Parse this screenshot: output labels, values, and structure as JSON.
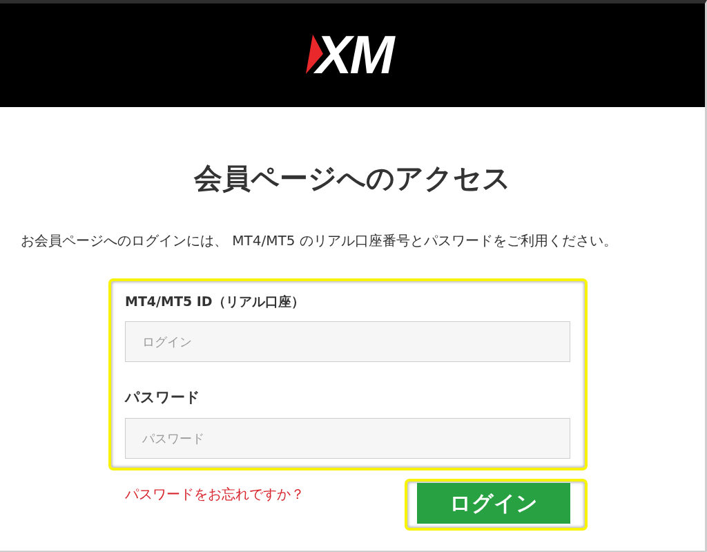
{
  "header": {
    "logo_text": "XM"
  },
  "title": "会員ページへのアクセス",
  "description": "お会員ページへのログインには、 MT4/MT5 のリアル口座番号とパスワードをご利用ください。",
  "form": {
    "highlighted": true,
    "fields": [
      {
        "label": "MT4/MT5 ID（リアル口座）",
        "placeholder": "ログイン"
      },
      {
        "label": "パスワード",
        "placeholder": "パスワード"
      }
    ]
  },
  "forgot_password_link": "パスワードをお忘れですか？",
  "login_button": {
    "label": "ログイン",
    "highlighted": true
  }
}
